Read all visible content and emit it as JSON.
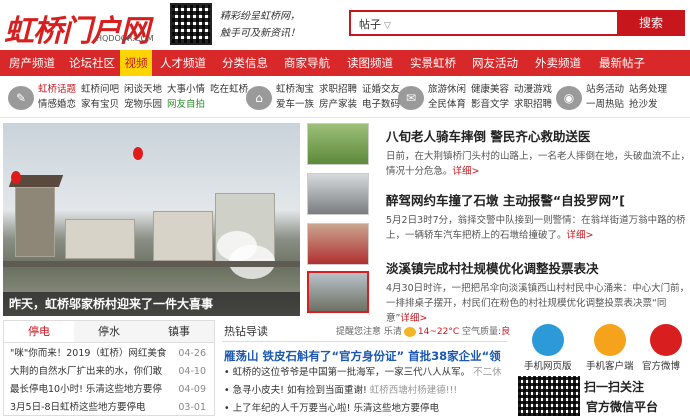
{
  "header": {
    "logo_text": "虹桥门户网",
    "logo_domain": "HQDOOR.COM",
    "slogan_line1": "精彩纷呈虹桥网，",
    "slogan_line2": "触手可及新资讯！",
    "search_category": "帖子",
    "search_placeholder": "",
    "search_button": "搜索"
  },
  "nav": {
    "items": [
      "房产频道",
      "论坛社区",
      "视频",
      "人才频道",
      "分类信息",
      "商家导航",
      "读图频道",
      "实景虹桥",
      "网友活动",
      "外卖频道",
      "最新帖子"
    ],
    "active_index": 2
  },
  "subnav": {
    "groups": [
      {
        "icon": "chat-icon",
        "row1": [
          "虹桥话题",
          "虹桥问吧",
          "闲谈天地",
          "大事小情",
          "吃在虹桥"
        ],
        "row2": [
          "情感婚恋",
          "家有宝贝",
          "宠物乐园",
          "网友自拍"
        ]
      },
      {
        "icon": "cart-icon",
        "row1": [
          "虹桥淘宝",
          "求职招聘",
          "证婚交友"
        ],
        "row2": [
          "爱车一族",
          "房产家装",
          "电子数码"
        ]
      },
      {
        "icon": "bubble-icon",
        "row1": [
          "旅游休闲",
          "健康美容",
          "动漫游戏"
        ],
        "row2": [
          "全民体育",
          "影音文学",
          "求职招聘"
        ]
      },
      {
        "icon": "pin-icon",
        "row1": [
          "站务活动",
          "站务处理"
        ],
        "row2": [
          "一周热贴",
          "抢沙发"
        ]
      }
    ]
  },
  "hero": {
    "caption": "昨天，虹桥邬家桥村迎来了一件大喜事"
  },
  "news": [
    {
      "title": "八旬老人骑车摔倒 警民齐心救助送医",
      "desc": "日前，在大荆镇桥门头村的山路上，一名老人摔倒在地，头破血流不止，情况十分危急。",
      "more": "详细>"
    },
    {
      "title": "醉驾网约车撞了石墩 主动报警“自投罗网”[",
      "desc": "5月2日3时7分，翁择交警中队接到一则警情：在翁垟街道万翁中路的桥上，一辆轿车汽车把桥上的石墩给撞破了。",
      "more": "详细>"
    },
    {
      "title": "淡溪镇完成村社规模优化调整投票表决",
      "desc": "4月30日时许，一把把吊伞向淡溪镇西山村村民中心涌来：中心大门前，一排排桌子摆开，村民们在粉色的村社规模优化调整投票表决票“同意”",
      "more": "详细>"
    }
  ],
  "tabs": {
    "labels": [
      "停电",
      "停水",
      "镇事"
    ],
    "active_index": 0,
    "items": [
      {
        "text": "\"咪\"你而来！2019（虹桥）网红美食",
        "date": "04-26"
      },
      {
        "text": "大荆的自然水厂扩出来的水，你们敢",
        "date": "04-10"
      },
      {
        "text": "最长停电10小时! 乐清这些地方要停",
        "date": "04-09"
      },
      {
        "text": "3月5日-8日虹桥这些地方要停电",
        "date": "03-01"
      }
    ]
  },
  "hot": {
    "label": "热钻导读",
    "weather_prefix": "提醒您注意",
    "weather_city": "乐清",
    "weather_temp": "14~22°C",
    "weather_aqi_label": "空气质量:",
    "weather_aqi": "良",
    "title": "雁荡山 铁皮石斛有了“官方身份证” 首批38家企业“领",
    "items": [
      {
        "text": "虹桥的这位爷爷是中国第一批海军，一家三代八人从军。",
        "extra": "不二休"
      },
      {
        "text": "急寻小皮夫! 如有捡到当面重谢!",
        "extra": "虹桥西塘村杨建德!!!"
      },
      {
        "text": "上了年纪的人千万要当心啦! 乐清这些地方要停电",
        "extra": ""
      }
    ]
  },
  "apps": [
    {
      "label": "手机网页版",
      "color": "#2c9ad8"
    },
    {
      "label": "手机客户端",
      "color": "#f5a31a"
    },
    {
      "label": "官方微博",
      "color": "#d81e1e"
    }
  ],
  "wechat": {
    "scan_text": "扫一扫关注",
    "official_text": "官方微信平台"
  },
  "colors": {
    "brand_red": "#d8282a",
    "active_yellow": "#ffd400",
    "link_blue": "#1a58b3"
  }
}
